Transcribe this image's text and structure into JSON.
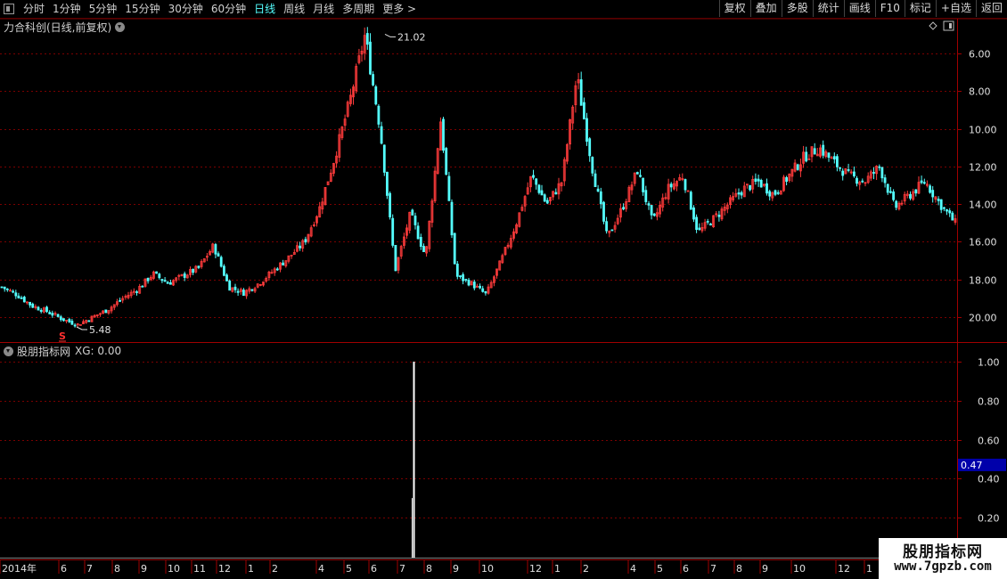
{
  "toolbar": {
    "periods": [
      "分时",
      "1分钟",
      "5分钟",
      "15分钟",
      "30分钟",
      "60分钟",
      "日线",
      "周线",
      "月线",
      "多周期",
      "更多 >"
    ],
    "active_period": "日线",
    "buttons": [
      "复权",
      "叠加",
      "多股",
      "统计",
      "画线",
      "F10",
      "标记",
      "+自选",
      "返回"
    ]
  },
  "main_panel": {
    "title": "力合科创(日线,前复权)",
    "high_label": "21.02",
    "low_label": "5.48",
    "signal_marker": "S",
    "y_ticks": [
      "20.00",
      "18.00",
      "16.00",
      "14.00",
      "12.00",
      "10.00",
      "8.00",
      "6.00"
    ]
  },
  "indicator_panel": {
    "title": "股朋指标网",
    "readout": "XG: 0.00",
    "y_ticks": [
      "1.00",
      "0.80",
      "0.60",
      "0.40",
      "0.20"
    ],
    "cursor_value": "0.47"
  },
  "x_axis": {
    "labels": [
      "2014年",
      "6",
      "7",
      "8",
      "9",
      "10",
      "11",
      "12",
      "1",
      "2",
      "4",
      "5",
      "6",
      "7",
      "8",
      "9",
      "10",
      "12",
      "1",
      "2",
      "4",
      "5",
      "6",
      "7",
      "8",
      "9",
      "10",
      "12",
      "1"
    ]
  },
  "watermark": {
    "line1": "股朋指标网",
    "line2": "www.7gpzb.com"
  },
  "colors": {
    "up": "#ff3b3b",
    "down": "#54ffff",
    "grid": "#7a0000",
    "axis_text": "#e0e0e0",
    "active_period": "#55ffff",
    "cursor_box": "#0000aa"
  },
  "chart_data": [
    {
      "type": "candlestick",
      "title": "力合科创(日线,前复权)",
      "ylim": [
        4.8,
        21.2
      ],
      "y_ticks": [
        6,
        8,
        10,
        12,
        14,
        16,
        18,
        20
      ],
      "annotations": [
        {
          "label": "21.02",
          "value": 21.02
        },
        {
          "label": "5.48",
          "value": 5.48
        }
      ],
      "close_path": [
        7.6,
        7.2,
        6.6,
        6.3,
        5.9,
        5.6,
        6.0,
        6.4,
        7.0,
        7.5,
        8.3,
        7.8,
        8.2,
        8.6,
        9.8,
        7.6,
        7.3,
        7.8,
        8.5,
        9.2,
        10.0,
        11.8,
        14.5,
        17.5,
        21.0,
        16.0,
        8.5,
        11.5,
        9.2,
        16.5,
        8.2,
        7.8,
        7.2,
        9.0,
        11.0,
        13.5,
        12.0,
        13.2,
        18.8,
        14.0,
        10.2,
        11.8,
        13.8,
        11.0,
        12.8,
        13.5,
        10.5,
        11.2,
        12.0,
        12.8,
        13.2,
        12.5,
        13.5,
        14.5,
        15.0,
        14.2,
        13.5,
        13.2,
        14.0,
        11.8,
        12.5,
        13.2,
        12.0,
        11.0
      ],
      "notes": "closing price path sampled at equal intervals from Jun 2014 to Feb 2017 (approx.)"
    },
    {
      "type": "bar",
      "title": "XG",
      "ylim": [
        0,
        1.06
      ],
      "y_ticks": [
        0.2,
        0.4,
        0.6,
        0.8,
        1.0
      ],
      "spikes": [
        {
          "label": "7",
          "value": 1.0
        }
      ],
      "baseline": 0
    }
  ]
}
